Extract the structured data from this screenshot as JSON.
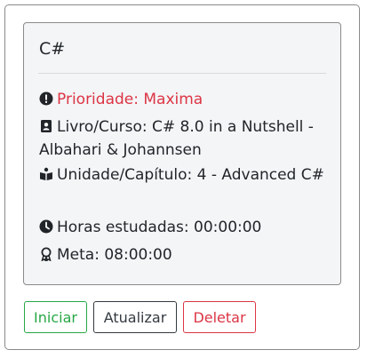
{
  "card": {
    "title": "C#",
    "priority_label": "Prioridade: Maxima",
    "book_label": "Livro/Curso: C# 8.0 in a Nutshell - Albahari & Johannsen",
    "unit_label": "Unidade/Capítulo: 4 - Advanced C#",
    "hours_label": "Horas estudadas: 00:00:00",
    "goal_label": "Meta: 08:00:00",
    "priority_color": "#dc3545"
  },
  "actions": {
    "start_label": "Iniciar",
    "update_label": "Atualizar",
    "delete_label": "Deletar"
  },
  "icons": {
    "priority": "exclamation-circle-icon",
    "book": "address-book-icon",
    "unit": "open-book-icon",
    "hours": "clock-icon",
    "goal": "award-icon"
  }
}
